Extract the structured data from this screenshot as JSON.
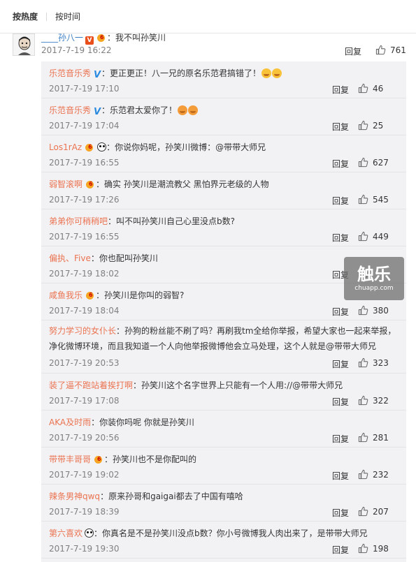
{
  "sort": {
    "hot": "按热度",
    "time": "按时间"
  },
  "main": {
    "user": "____孙八一",
    "colon": "：",
    "text": "我不叫孙笑川",
    "date": "2017-7-19 16:22",
    "reply": "回复",
    "likes": "761"
  },
  "replies": [
    {
      "user": "乐范音乐秀",
      "badges": [
        "v-blue"
      ],
      "text": "更正更正！八一兄的原名乐范君搞错了！",
      "emoji": 2,
      "date": "2017-7-19 17:10",
      "reply": "回复",
      "likes": "46"
    },
    {
      "user": "乐范音乐秀",
      "badges": [
        "v-blue"
      ],
      "text": "乐范君太爱你了！",
      "emoji": 2,
      "date": "2017-7-19 17:04",
      "reply": "回复",
      "likes": "25"
    },
    {
      "user": "Los1rAz",
      "badges": [
        "vip",
        "panda"
      ],
      "text": "你说你妈呢，孙笑川微博：@带带大师兄",
      "emoji": 0,
      "date": "2017-7-19 16:55",
      "reply": "回复",
      "likes": "627"
    },
    {
      "user": "弱智滚啊",
      "badges": [
        "vip"
      ],
      "text": "确实 孙笑川是潮流教父 黑怕界元老级的人物",
      "emoji": 0,
      "date": "2017-7-19 17:26",
      "reply": "回复",
      "likes": "545"
    },
    {
      "user": "弟弟你可稍稍吧",
      "badges": [],
      "text": "叫不叫孙笑川自己心里没点b数?",
      "emoji": 0,
      "date": "2017-7-19 16:55",
      "reply": "回复",
      "likes": "449"
    },
    {
      "user": "偏执、Five",
      "badges": [],
      "text": "你也配叫孙笑川",
      "emoji": 0,
      "date": "2017-7-19 18:02",
      "reply": "回复",
      "likes": ""
    },
    {
      "user": "咸鱼我乐",
      "badges": [
        "vip"
      ],
      "text": "孙笑川是你叫的弱智?",
      "emoji": 0,
      "date": "2017-7-19 18:04",
      "reply": "回复",
      "likes": "380"
    },
    {
      "user": "努力学习的女仆长",
      "badges": [],
      "text": "孙狗的粉丝能不刷了吗？再刷我tm全给你举报，希望大家也一起来举报，净化微博环境，而且我知道一个人向他举报微博他会立马处理，这个人就是@带带大师兄",
      "emoji": 0,
      "date": "2017-7-19 20:53",
      "reply": "回复",
      "likes": "323",
      "tall": true
    },
    {
      "user": "装了逼不跑站着挨打啊",
      "badges": [],
      "text": "孙笑川这个名字世界上只能有一个人用://@带带大师兄",
      "emoji": 0,
      "date": "2017-7-19 17:08",
      "reply": "回复",
      "likes": "322"
    },
    {
      "user": "AKA及时雨",
      "badges": [],
      "text": "你装你吗呢 你就是孙笑川",
      "emoji": 0,
      "date": "2017-7-19 20:56",
      "reply": "回复",
      "likes": "281"
    },
    {
      "user": "带带丰哥哥",
      "badges": [
        "vip"
      ],
      "text": "孙笑川也不是你配叫的",
      "emoji": 0,
      "date": "2017-7-19 19:02",
      "reply": "回复",
      "likes": "232"
    },
    {
      "user": "辣条男神qwq",
      "badges": [],
      "text": "原来孙哥和gaigai都去了中国有嘻哈",
      "emoji": 0,
      "date": "2017-7-19 18:39",
      "reply": "回复",
      "likes": "207"
    },
    {
      "user": "第六喜欢",
      "badges": [
        "panda"
      ],
      "text": "你真名是不是孙笑川没点b数？你小号微博我人肉出来了，是带带大师兄",
      "emoji": 0,
      "date": "2017-7-19 19:30",
      "reply": "回复",
      "likes": "198"
    }
  ],
  "watermark": {
    "big": "触乐",
    "small": "chuapp.com"
  },
  "colors": {
    "username_blue": "#3a7fc4",
    "username_orange": "#eb7350",
    "reply_bg": "#f2f2f5"
  }
}
